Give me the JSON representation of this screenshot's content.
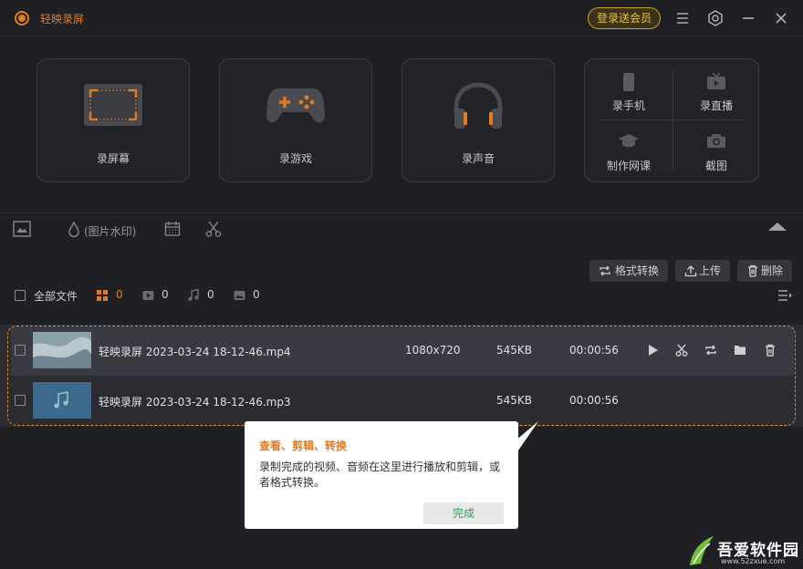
{
  "app": {
    "title": "轻映录屏",
    "login_button": "登录送会员",
    "accent_color": "#e07b24",
    "icons": [
      "menu-icon",
      "settings-icon",
      "minimize-icon",
      "close-icon"
    ]
  },
  "tiles": {
    "record_screen": "录屏幕",
    "record_game": "录游戏",
    "record_audio": "录声音",
    "record_phone": "录手机",
    "live_stream": "录直播",
    "make_course": "制作网课",
    "screenshot": "截图"
  },
  "toolbar": {
    "watermark": "(图片水印)",
    "icons": [
      "folder-icon",
      "drop-icon",
      "calendar-icon",
      "scissors-icon",
      "collapse-icon"
    ]
  },
  "actions": {
    "convert": "格式转换",
    "upload": "上传",
    "delete": "删除"
  },
  "filter": {
    "all_files": "全部文件",
    "all_count": "0",
    "video_count": "0",
    "audio_count": "0",
    "image_count": "0"
  },
  "files": [
    {
      "name": "轻映录屏 2023-03-24 18-12-46.mp4",
      "resolution": "1080x720",
      "size": "545KB",
      "duration": "00:00:56"
    },
    {
      "name": "轻映录屏 2023-03-24 18-12-46.mp3",
      "resolution": "",
      "size": "545KB",
      "duration": "00:00:56"
    }
  ],
  "tooltip": {
    "title": "查看、剪辑、转换",
    "body": "录制完成的视频、音频在这里进行播放和剪辑，或者格式转换。",
    "button": "完成"
  },
  "site_watermark": {
    "name": "吾爱软件园",
    "url": "www.52zxue.com"
  }
}
